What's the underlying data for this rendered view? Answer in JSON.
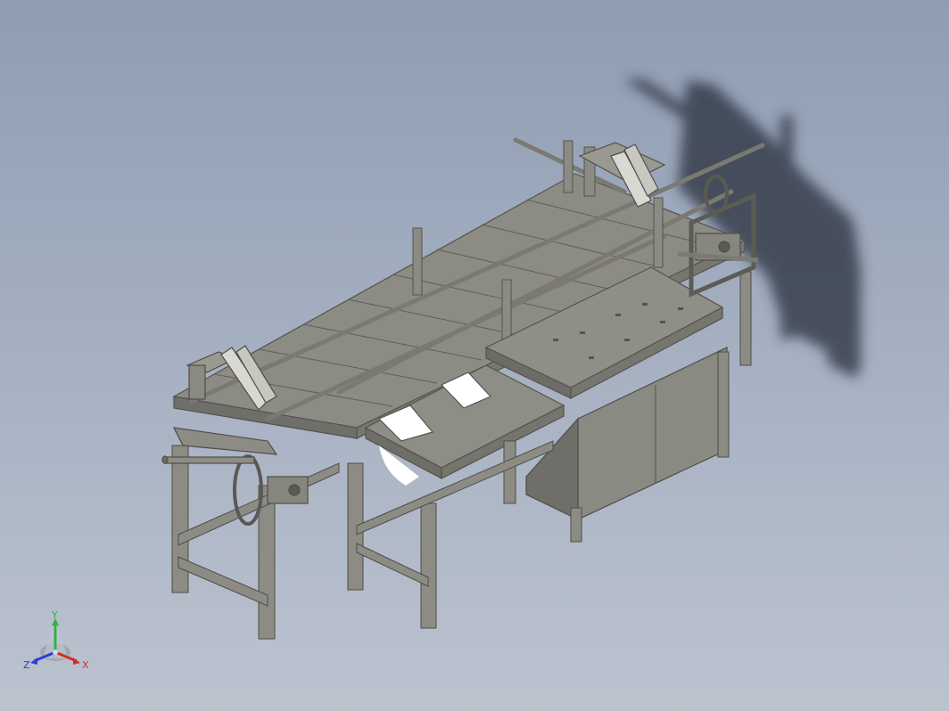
{
  "viewport": {
    "background_top": "#8f9db3",
    "background_bottom": "#bcc3cf",
    "model_color": "#8f8e86",
    "shadow_color": "#2e3440"
  },
  "triad": {
    "x_label": "X",
    "y_label": "Y",
    "z_label": "Z",
    "x_color": "#d22d2d",
    "y_color": "#2fb344",
    "z_color": "#2b3fd6"
  }
}
